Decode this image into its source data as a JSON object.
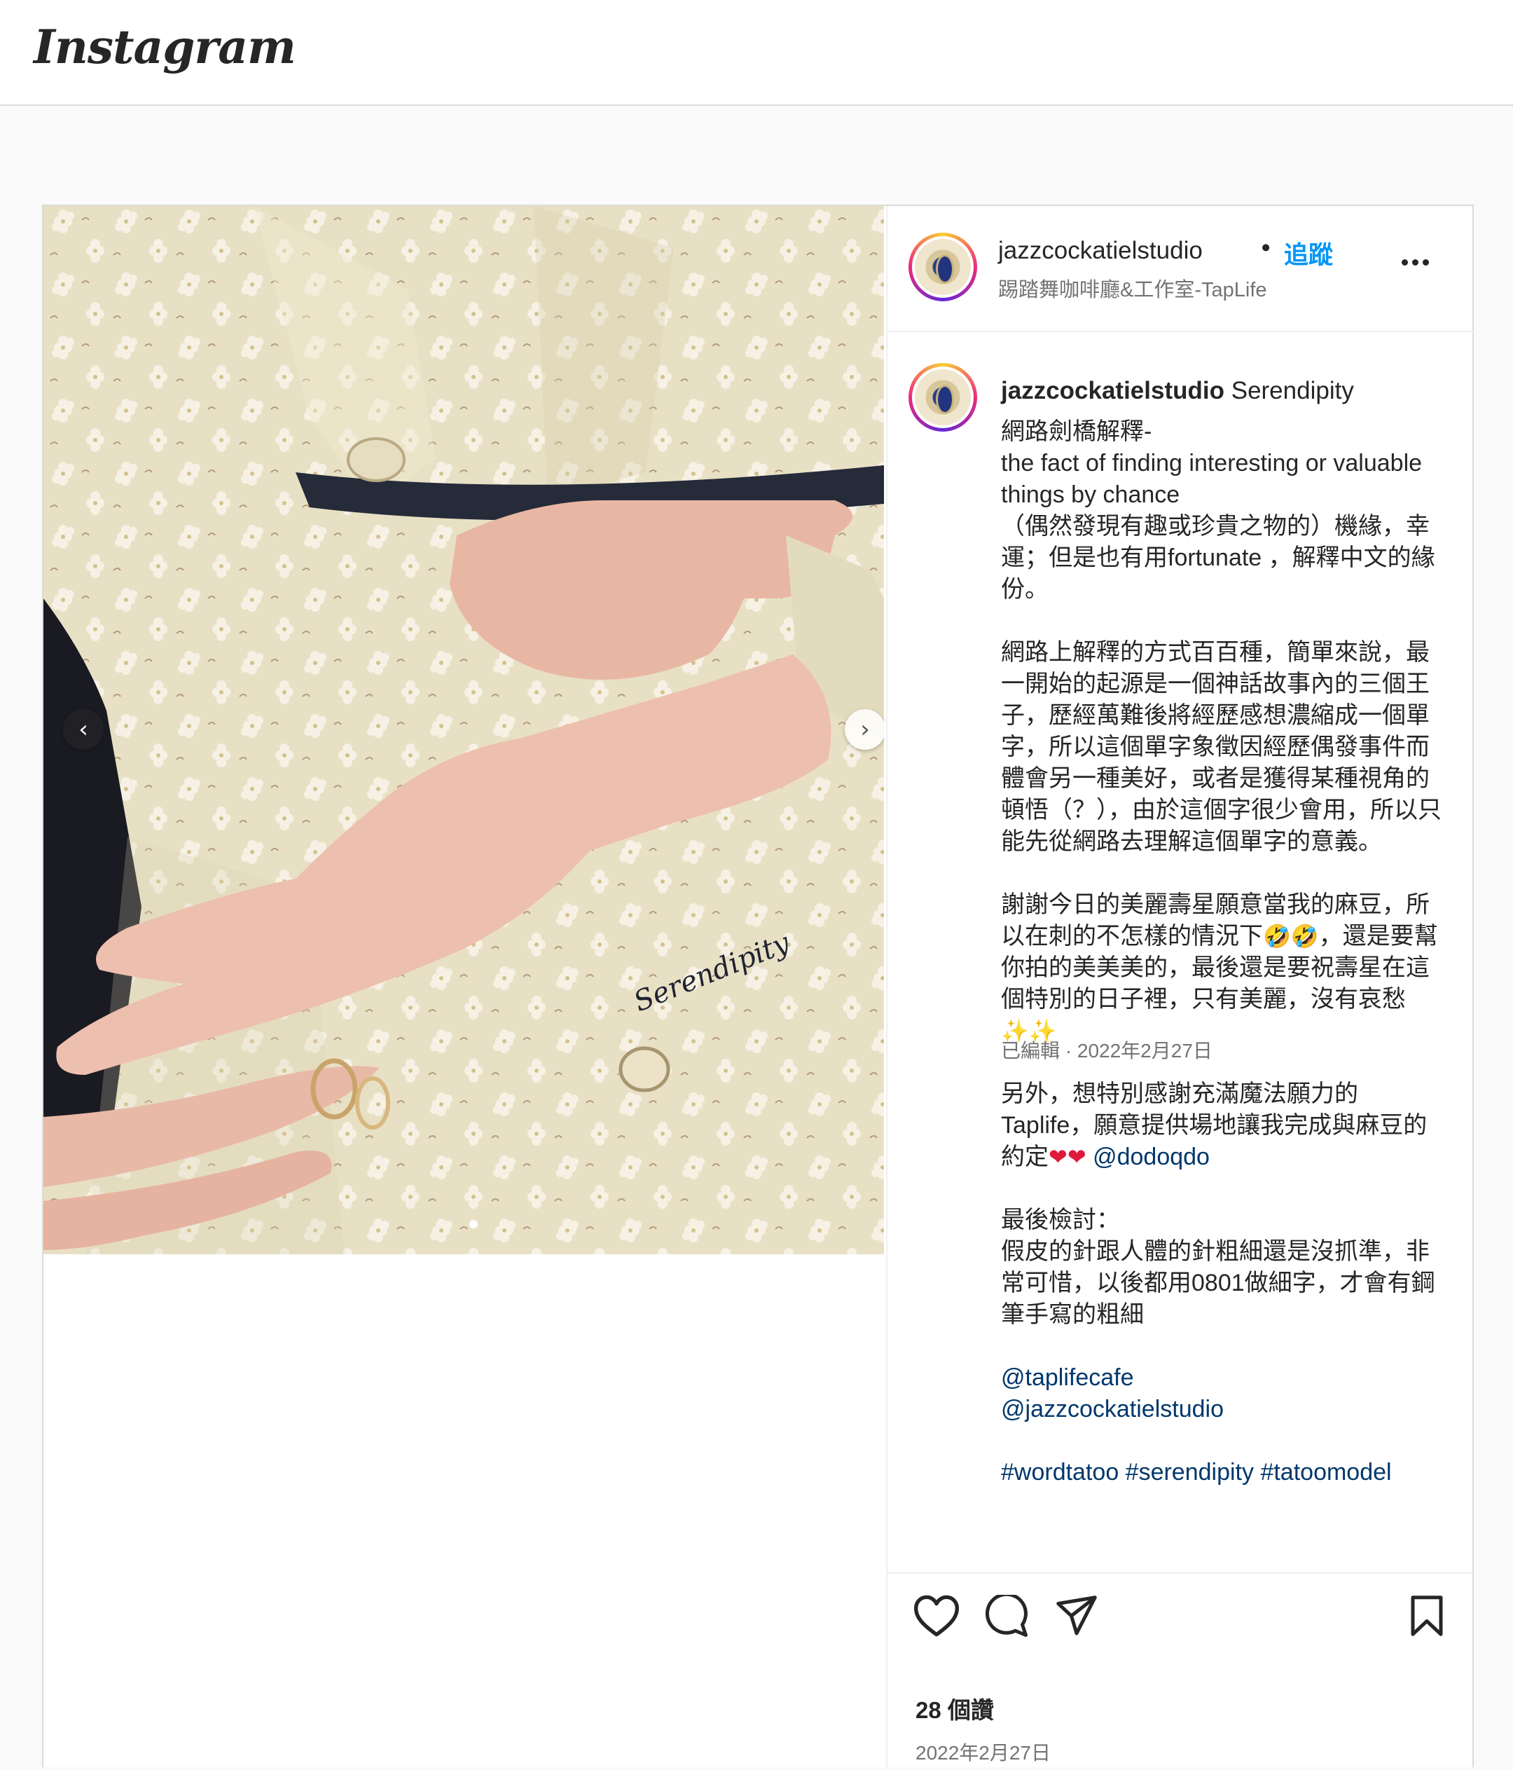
{
  "app": {
    "logo": "Instagram"
  },
  "post": {
    "author": "jazzcockatielstudio",
    "separator": "•",
    "follow_label": "追蹤",
    "location": "踢踏舞咖啡廳&工作室-TapLife",
    "caption_user": "jazzcockatielstudio",
    "caption_title": "Serendipity",
    "caption_lines": {
      "l1": "網路劍橋解釋-",
      "l2": "the fact of finding interesting or valuable things by chance",
      "l3": "（偶然發現有趣或珍貴之物的）機緣，幸運；但是也有用fortunate ，解釋中文的緣份。",
      "l4": "網路上解釋的方式百百種，簡單來說，最一開始的起源是一個神話故事內的三個王子，歷經萬難後將經歷感想濃縮成一個單字，所以這個單字象徵因經歷偶發事件而體會另一種美好，或者是獲得某種視角的頓悟（？），由於這個字很少會用，所以只能先從網路去理解這個單字的意義。",
      "l5a": "謝謝今日的美麗壽星願意當我的麻豆，所以在刺的不怎樣的情況下",
      "l5b": "，還是要幫你拍的美美美的，最後還是要祝壽星在這個特別的日子裡，只有美麗，沒有哀愁",
      "l6a": "另外，想特別感謝充滿魔法願力的Taplife，願意提供場地讓我完成與麻豆的約定",
      "mention_dodo": "@dodoqdo",
      "l7": "最後檢討：",
      "l8": "假皮的針跟人體的針粗細還是沒抓準，非常可惜，以後都用0801做細字，才會有鋼筆手寫的粗細",
      "mention_cafe": "@taplifecafe",
      "mention_studio": "@jazzcockatielstudio",
      "hashtags": "#wordtatoo #serendipity #tatoomodel"
    },
    "emoji": {
      "laugh": "🤣",
      "heart": "❤",
      "sparkle": "✨"
    },
    "edited_meta": "已編輯 · 2022年2月27日",
    "likes": "28 個讚",
    "date": "2022年2月27日",
    "carousel": {
      "current": 1,
      "prev": "‹",
      "next": "›"
    },
    "photo_text": "Serendipity"
  },
  "icons": [
    "heart-icon",
    "comment-icon",
    "share-icon",
    "bookmark-icon",
    "more-icon"
  ],
  "colors": {
    "follow": "#0095f6",
    "link": "#00376b",
    "muted": "#737373"
  }
}
